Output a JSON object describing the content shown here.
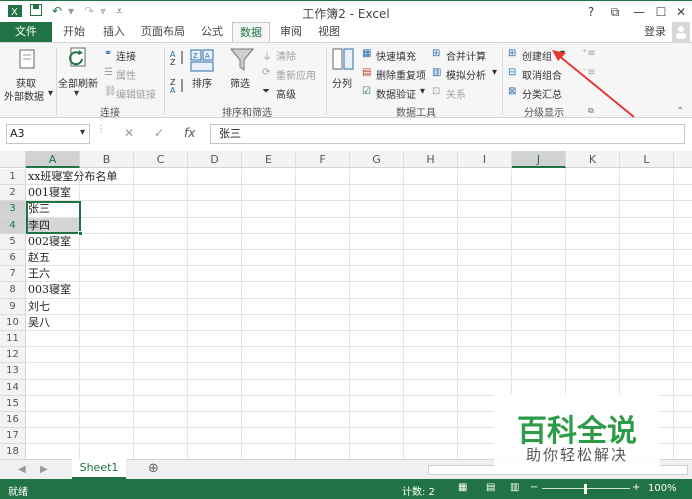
{
  "window": {
    "title": "工作簿2 - Excel",
    "controls": [
      "?",
      "⧉",
      "—",
      "☐",
      "✕"
    ]
  },
  "tabs": [
    "文件",
    "开始",
    "插入",
    "页面布局",
    "公式",
    "数据",
    "审阅",
    "视图"
  ],
  "account": "登录",
  "ribbon": {
    "get_external": {
      "line1": "获取",
      "line2": "外部数据"
    },
    "refresh_all": "全部刷新",
    "connections": {
      "connect": "连接",
      "properties": "属性",
      "edit_links": "编辑链接",
      "group_label": "连接"
    },
    "sort_filter": {
      "sort": "排序",
      "filter": "筛选",
      "clear": "清除",
      "reapply": "重新应用",
      "advanced": "高级",
      "group_label": "排序和筛选"
    },
    "data_tools": {
      "split": "分列",
      "flash_fill": "快速填充",
      "remove_dup": "删除重复项",
      "validation": "数据验证",
      "consolidate": "合并计算",
      "what_if": "模拟分析",
      "relations": "关系",
      "group_label": "数据工具"
    },
    "outline": {
      "group": "创建组",
      "ungroup": "取消组合",
      "subtotal": "分类汇总",
      "group_label": "分级显示"
    }
  },
  "formula_bar": {
    "name_box": "A3",
    "fx": "fx",
    "value": "张三"
  },
  "columns": [
    "A",
    "B",
    "C",
    "D",
    "E",
    "F",
    "G",
    "H",
    "I",
    "J",
    "K",
    "L"
  ],
  "rows": [
    {
      "num": "1",
      "a": "xx班寝室分布名单"
    },
    {
      "num": "2",
      "a": "001寝室"
    },
    {
      "num": "3",
      "a": "张三"
    },
    {
      "num": "4",
      "a": "李四"
    },
    {
      "num": "5",
      "a": "002寝室"
    },
    {
      "num": "6",
      "a": "赵五"
    },
    {
      "num": "7",
      "a": "王六"
    },
    {
      "num": "8",
      "a": "003寝室"
    },
    {
      "num": "9",
      "a": "刘七"
    },
    {
      "num": "10",
      "a": "吴八"
    },
    {
      "num": "11",
      "a": ""
    },
    {
      "num": "12",
      "a": ""
    },
    {
      "num": "13",
      "a": ""
    },
    {
      "num": "14",
      "a": ""
    },
    {
      "num": "15",
      "a": ""
    },
    {
      "num": "16",
      "a": ""
    },
    {
      "num": "17",
      "a": ""
    },
    {
      "num": "18",
      "a": ""
    }
  ],
  "sheet_tab": "Sheet1",
  "status": {
    "ready": "就绪",
    "count": "计数: 2",
    "zoom": "100%"
  },
  "watermark": {
    "title": "百科全说",
    "subtitle": "助你轻松解决"
  },
  "colors": {
    "accent": "#217346",
    "arrow": "#e53935",
    "watermark": "#2e9b48"
  }
}
